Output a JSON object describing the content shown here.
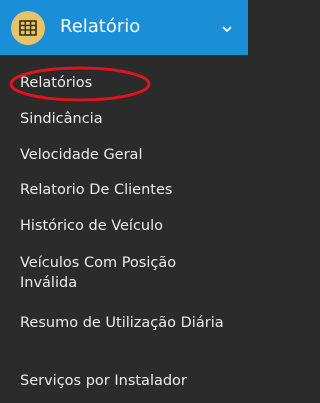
{
  "header": {
    "title": "Relatório",
    "icon": "table-icon",
    "chevron": "chevron-down-icon"
  },
  "menu": {
    "items": [
      {
        "label": "Relatórios"
      },
      {
        "label": "Sindicância"
      },
      {
        "label": "Velocidade Geral"
      },
      {
        "label": "Relatorio De Clientes"
      },
      {
        "label": "Histórico de Veículo"
      },
      {
        "label": "Veículos Com Posição Inválida"
      },
      {
        "label": "Resumo de Utilização Diária"
      },
      {
        "label": "Serviços por Instalador"
      }
    ]
  },
  "colors": {
    "header_bg": "#1a8fd8",
    "menu_bg": "#2b2b2b",
    "icon_bg": "#e4c36a",
    "highlight": "#e0141e"
  }
}
